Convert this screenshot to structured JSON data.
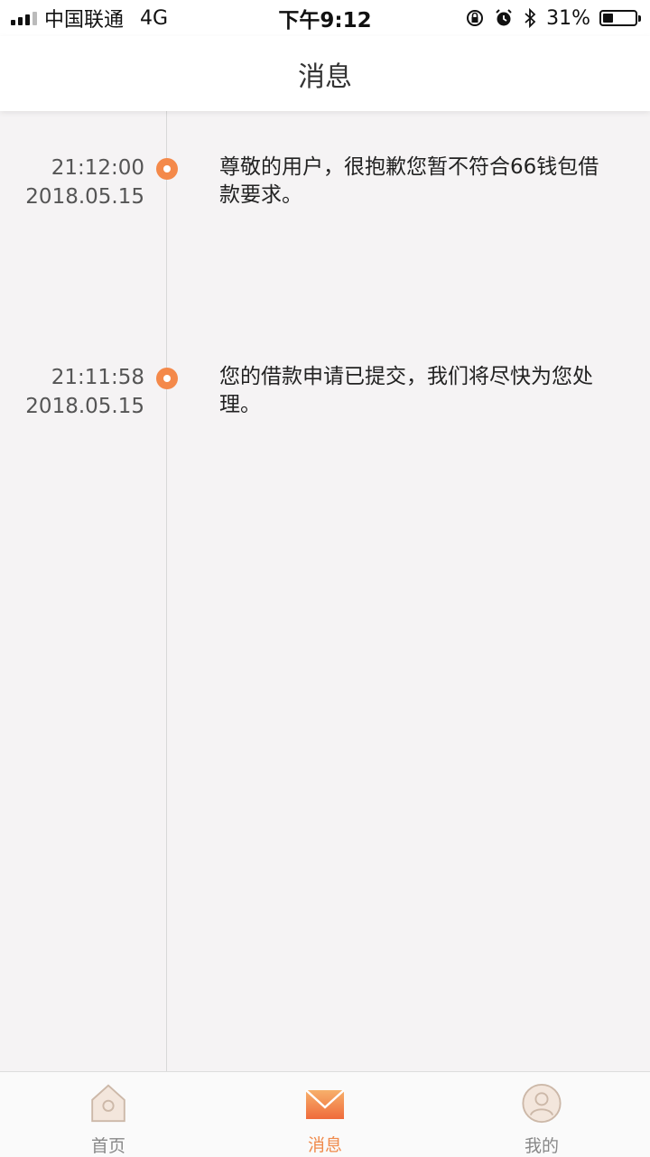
{
  "status_bar": {
    "carrier": "中国联通",
    "network": "4G",
    "time": "下午9:12",
    "battery_percent": "31%",
    "battery_level": 0.31,
    "icons": [
      "orientation-lock-icon",
      "alarm-icon",
      "bluetooth-icon",
      "battery-icon"
    ]
  },
  "header": {
    "title": "消息"
  },
  "messages": [
    {
      "time": "21:12:00",
      "date": "2018.05.15",
      "text": "尊敬的用户，很抱歉您暂不符合66钱包借款要求。"
    },
    {
      "time": "21:11:58",
      "date": "2018.05.15",
      "text": "您的借款申请已提交，我们将尽快为您处理。"
    }
  ],
  "tabbar": {
    "items": [
      {
        "label": "首页",
        "icon": "home-icon",
        "active": false
      },
      {
        "label": "消息",
        "icon": "mail-icon",
        "active": true
      },
      {
        "label": "我的",
        "icon": "profile-icon",
        "active": false
      }
    ]
  },
  "colors": {
    "accent": "#f08a4b",
    "background": "#f5f3f4",
    "inactive_tab": "#888888"
  }
}
